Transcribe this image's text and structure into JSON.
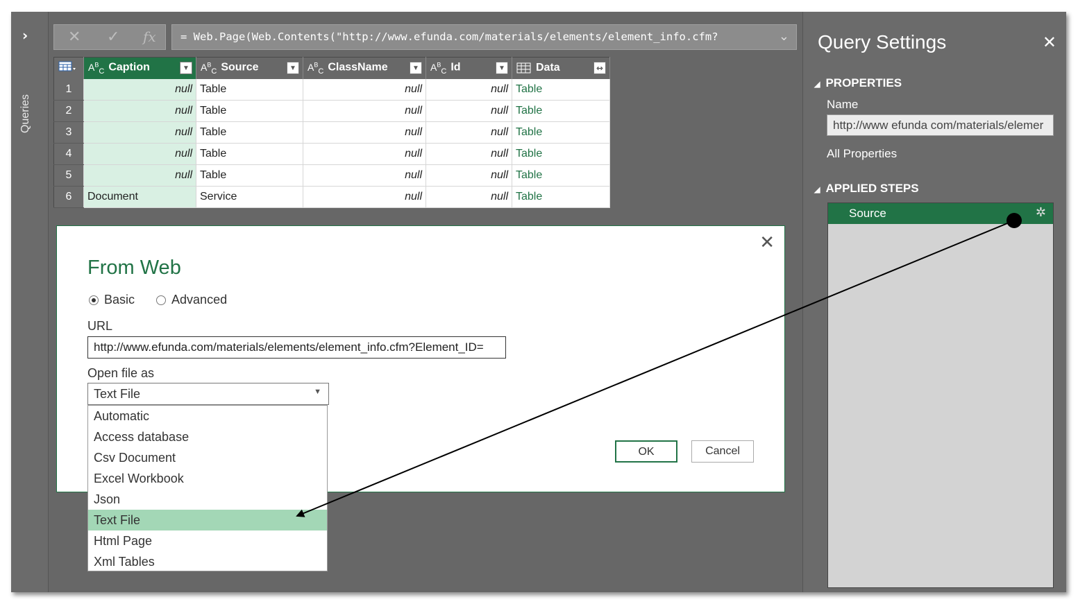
{
  "left_rail": {
    "label": "Queries",
    "expand_glyph": "›"
  },
  "formula": {
    "cancel_glyph": "✕",
    "commit_glyph": "✓",
    "fx_glyph": "fx",
    "text": "= Web.Page(Web.Contents(\"http://www.efunda.com/materials/elements/element_info.cfm?",
    "expand_glyph": "⌄"
  },
  "table": {
    "columns": [
      {
        "type": "ABC",
        "name": "Caption"
      },
      {
        "type": "ABC",
        "name": "Source"
      },
      {
        "type": "ABC",
        "name": "ClassName"
      },
      {
        "type": "ABC",
        "name": "Id"
      },
      {
        "type": "table",
        "name": "Data"
      }
    ],
    "rows": [
      {
        "n": "1",
        "caption": "null",
        "source": "Table",
        "classname": "null",
        "id": "null",
        "data": "Table"
      },
      {
        "n": "2",
        "caption": "null",
        "source": "Table",
        "classname": "null",
        "id": "null",
        "data": "Table"
      },
      {
        "n": "3",
        "caption": "null",
        "source": "Table",
        "classname": "null",
        "id": "null",
        "data": "Table"
      },
      {
        "n": "4",
        "caption": "null",
        "source": "Table",
        "classname": "null",
        "id": "null",
        "data": "Table"
      },
      {
        "n": "5",
        "caption": "null",
        "source": "Table",
        "classname": "null",
        "id": "null",
        "data": "Table"
      },
      {
        "n": "6",
        "caption": "Document",
        "source": "Service",
        "classname": "null",
        "id": "null",
        "data": "Table"
      }
    ]
  },
  "dialog": {
    "title": "From Web",
    "radio_basic": "Basic",
    "radio_advanced": "Advanced",
    "url_label": "URL",
    "url_value": "http://www.efunda.com/materials/elements/element_info.cfm?Element_ID=",
    "open_as_label": "Open file as",
    "open_as_value": "Text File",
    "ok": "OK",
    "cancel": "Cancel",
    "options": [
      "Automatic",
      "Access database",
      "Csv Document",
      "Excel Workbook",
      "Json",
      "Text File",
      "Html Page",
      "Xml Tables"
    ],
    "selected_option": "Text File"
  },
  "query_settings": {
    "title": "Query Settings",
    "properties_header": "PROPERTIES",
    "name_label": "Name",
    "name_value": "http://www efunda com/materials/elemer",
    "all_properties": "All Properties",
    "applied_steps_header": "APPLIED STEPS",
    "steps": [
      "Source"
    ]
  },
  "colors": {
    "accent": "#217346",
    "selected_option": "#a3d7b6",
    "caption_fill": "#d9f0e3"
  }
}
